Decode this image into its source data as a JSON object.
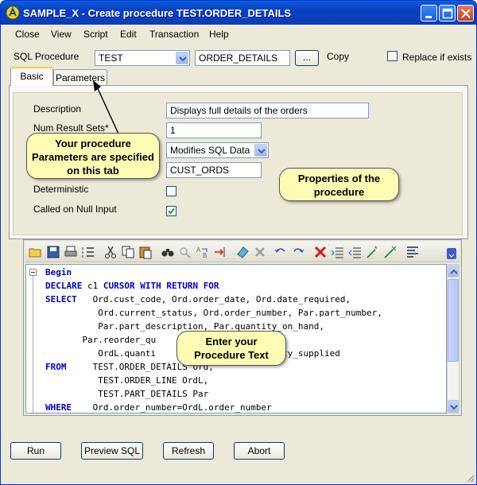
{
  "window": {
    "title": "SAMPLE_X - Create procedure TEST.ORDER_DETAILS",
    "titlebar_color": "#0a47c9"
  },
  "menu": [
    "Close",
    "View",
    "Script",
    "Edit",
    "Transaction",
    "Help"
  ],
  "header": {
    "sql_procedure_label": "SQL Procedure",
    "schema_value": "TEST",
    "procedure_name": "ORDER_DETAILS",
    "browse_label": "...",
    "copy_label": "Copy",
    "replace_label": "Replace if exists",
    "replace_checked": false
  },
  "tabs": [
    {
      "label": "Basic",
      "active": true
    },
    {
      "label": "Parameters",
      "active": false
    }
  ],
  "basic": {
    "description_label": "Description",
    "description_value": "Displays full details of the orders",
    "num_result_sets_label": "Num Result Sets*",
    "num_result_sets_value": "1",
    "sql_access_value": "Modifies SQL Data",
    "specific_name_value": "CUST_ORDS",
    "deterministic_label": "Deterministic",
    "deterministic_checked": false,
    "null_input_label": "Called on Null Input",
    "null_input_checked": true
  },
  "code": {
    "lines": [
      {
        "kw": "Begin",
        "text": ""
      },
      {
        "kw": "DECLARE",
        "text": " c1 CURSOR WITH RETURN FOR"
      },
      {
        "kw": "SELECT",
        "text": "   Ord.cust_code, Ord.order_date, Ord.date_required,"
      },
      {
        "kw": "",
        "text": "          Ord.current_status, Ord.order_number, Par.part_number,"
      },
      {
        "kw": "",
        "text": "          Par.part_description, Par.quantity_on_hand,"
      },
      {
        "kw": "",
        "text": "       Par.reorder_qu"
      },
      {
        "kw": "",
        "text": "          OrdL.quanti                  quantity_supplied"
      },
      {
        "kw": "FROM",
        "text": "     TEST.ORDER_DETAILS Ord,"
      },
      {
        "kw": "",
        "text": "          TEST.ORDER_LINE OrdL,"
      },
      {
        "kw": "",
        "text": "          TEST.PART_DETAILS Par"
      },
      {
        "kw": "WHERE",
        "text": "    Ord.order_number=OrdL.order_number"
      }
    ]
  },
  "callouts": {
    "parameters_note": "Your procedure Parameters are specified on this tab",
    "properties_note": "Properties of the procedure",
    "procedure_text_note": "Enter your Procedure Text"
  },
  "buttons": {
    "run": "Run",
    "preview_sql": "Preview SQL",
    "refresh": "Refresh",
    "abort": "Abort"
  }
}
